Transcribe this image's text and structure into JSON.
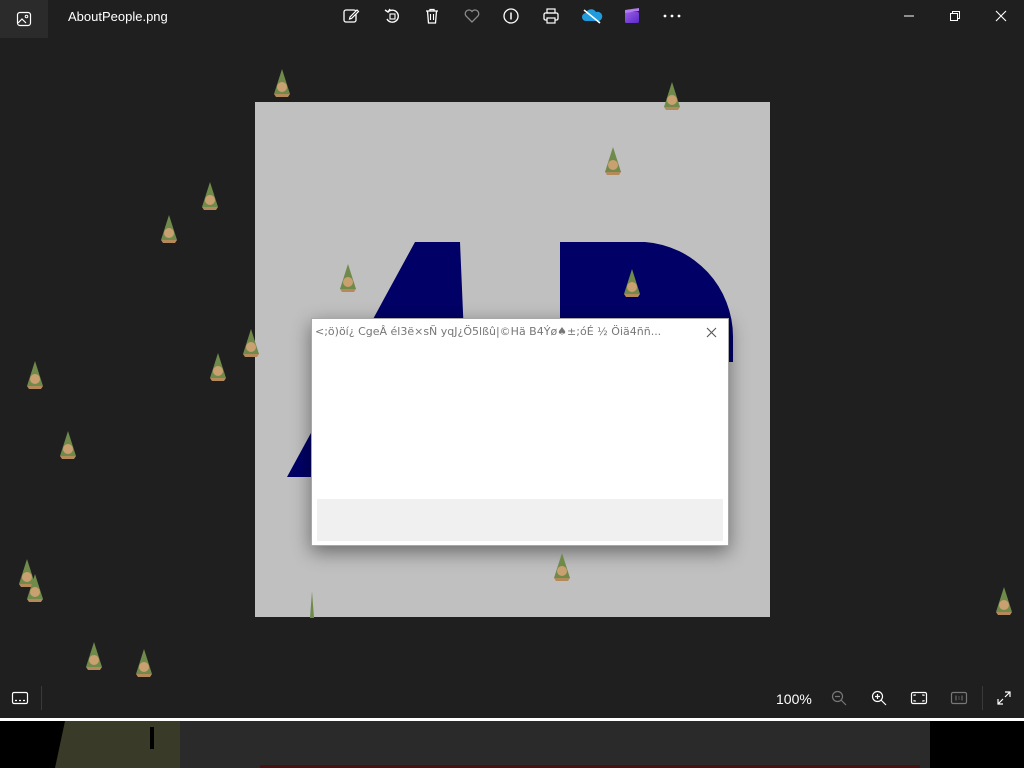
{
  "window": {
    "file_name": "AboutPeople.png"
  },
  "toolbar": {
    "edit_icon": "edit-image-icon",
    "rotate_icon": "rotate-icon",
    "delete_icon": "trash-icon",
    "favorite_icon": "heart-icon",
    "info_icon": "info-icon",
    "print_icon": "print-icon",
    "onedrive_icon": "onedrive-cloud-icon",
    "clipchamp_icon": "clipchamp-icon",
    "more_icon": "more-icon"
  },
  "dialog": {
    "title": "<;ö)öí¿ CgeÂ él3ë×sÑ yqJ¿Ö5lßû|©Hä B4Ýø♠±;óÉ ½ Öiä4ññ..."
  },
  "bottom": {
    "zoom_label": "100%"
  },
  "colors": {
    "background": "#1f1f1f",
    "image_bg": "#c0c0c0",
    "letters": "#000066",
    "dialog_footer": "#f0f0f0"
  }
}
